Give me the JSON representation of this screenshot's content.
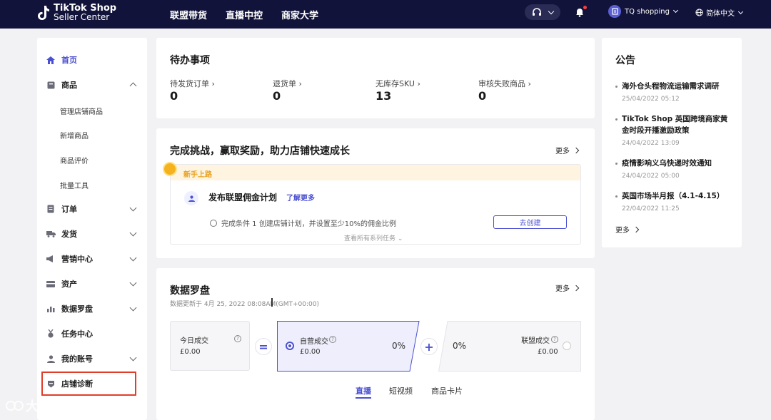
{
  "header": {
    "logo_line1": "TikTok Shop",
    "logo_line2": "Seller Center",
    "nav": [
      "联盟带货",
      "直播中控",
      "商家大学"
    ],
    "shop_name": "TQ shopping",
    "language": "简体中文",
    "colors": {
      "bar": "#12133a",
      "accent": "#4b50d1",
      "notify_dot": "#ff3b3b"
    }
  },
  "sidebar": {
    "items": [
      {
        "label": "首页",
        "icon": "home-icon",
        "active": true
      },
      {
        "label": "商品",
        "icon": "box-icon",
        "expanded": true
      },
      {
        "label": "订单",
        "icon": "order-icon"
      },
      {
        "label": "发货",
        "icon": "truck-icon"
      },
      {
        "label": "营销中心",
        "icon": "megaphone-icon"
      },
      {
        "label": "资产",
        "icon": "wallet-icon"
      },
      {
        "label": "数据罗盘",
        "icon": "chart-icon"
      },
      {
        "label": "任务中心",
        "icon": "medal-icon"
      },
      {
        "label": "我的账号",
        "icon": "user-icon"
      },
      {
        "label": "店铺诊断",
        "icon": "diagnosis-icon"
      }
    ],
    "sub_items": [
      "管理店铺商品",
      "新增商品",
      "商品评价",
      "批量工具"
    ]
  },
  "todo": {
    "title": "待办事项",
    "items": [
      {
        "label": "待发货订单",
        "value": "0"
      },
      {
        "label": "退货单",
        "value": "0"
      },
      {
        "label": "无库存SKU",
        "value": "13"
      },
      {
        "label": "审核失败商品",
        "value": "0"
      }
    ]
  },
  "challenge": {
    "title": "完成挑战，赢取奖励，助力店铺快速成长",
    "more": "更多",
    "banner": "新手上路",
    "plan_title": "发布联盟佣金计划",
    "plan_link": "了解更多",
    "condition": "完成条件 1  创建店铺计划，并设置至少10%的佣金比例",
    "create_button": "去创建",
    "view_all": "查看所有系列任务"
  },
  "compass": {
    "title": "数据罗盘",
    "more": "更多",
    "updated": "数据更新于 4月 25, 2022 08:08AM(GMT+00:00)",
    "today_label": "今日成交",
    "today_value": "£0.00",
    "op_equals": "=",
    "self_label": "自营成交",
    "self_value": "£0.00",
    "self_pct": "0%",
    "op_plus": "+",
    "affiliate_pct": "0%",
    "affiliate_label": "联盟成交",
    "affiliate_value": "£0.00",
    "tabs": [
      "直播",
      "短视频",
      "商品卡片"
    ]
  },
  "notices": {
    "title": "公告",
    "items": [
      {
        "title": "海外仓头程物流运输需求调研",
        "date": "25/04/2022 05:12"
      },
      {
        "title": "TikTok Shop 英国跨境商家黄金时段开播激励政策",
        "date": "24/04/2022 13:09"
      },
      {
        "title": "疫情影响义乌快递时效通知",
        "date": "24/04/2022 05:00"
      },
      {
        "title": "英国市场半月报（4.1-4.15）",
        "date": "22/04/2022 11:25"
      }
    ],
    "more": "更多"
  },
  "watermark": "大数跨境"
}
